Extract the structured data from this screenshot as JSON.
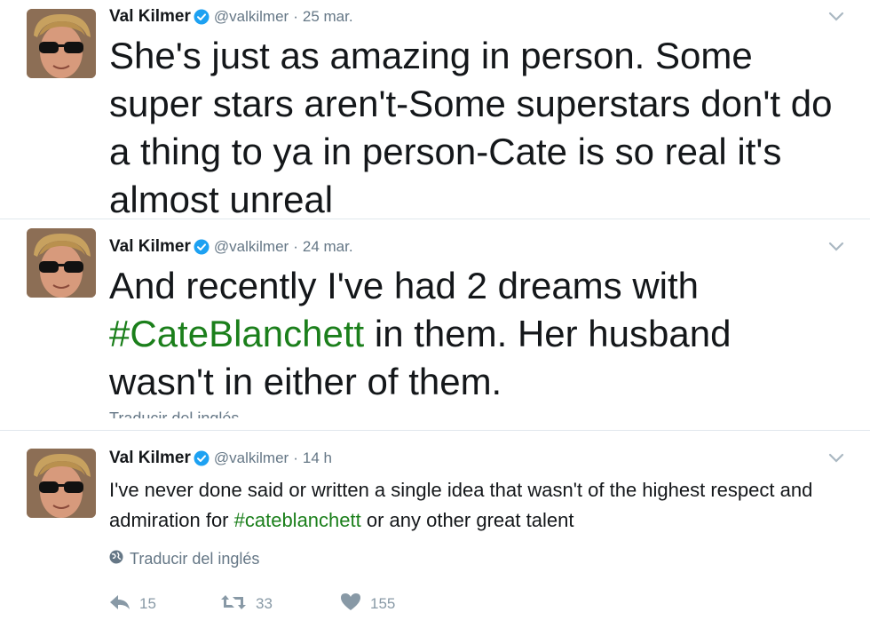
{
  "tweets": [
    {
      "author": "Val Kilmer",
      "handle": "@valkilmer",
      "separator": "·",
      "time": "25 mar.",
      "text_parts": [
        {
          "text": "She's just as amazing in person. Some super stars aren't-Some superstars don't do a thing to ya in person-Cate is so real it's almost unreal",
          "hashtag": false
        }
      ]
    },
    {
      "author": "Val Kilmer",
      "handle": "@valkilmer",
      "separator": "·",
      "time": "24 mar.",
      "text_parts": [
        {
          "text": "And recently I've had 2 dreams with ",
          "hashtag": false
        },
        {
          "text": "#CateBlanchett",
          "hashtag": true
        },
        {
          "text": " in them. Her husband wasn't in either of them.",
          "hashtag": false
        }
      ],
      "cut_text": "Traducir del inglés"
    },
    {
      "author": "Val Kilmer",
      "handle": "@valkilmer",
      "separator": "·",
      "time": "14 h",
      "text_parts": [
        {
          "text": "I've never done said or written a single idea that wasn't of the highest respect and admiration for ",
          "hashtag": false
        },
        {
          "text": "#cateblanchett",
          "hashtag": true
        },
        {
          "text": " or any other great talent",
          "hashtag": false
        }
      ],
      "translate_label": "Traducir del inglés",
      "actions": {
        "replies": "15",
        "retweets": "33",
        "likes": "155"
      }
    }
  ],
  "icons": {
    "verified": "verified-badge-icon",
    "chevron": "chevron-down-icon",
    "globe": "globe-icon",
    "reply": "reply-icon",
    "retweet": "retweet-icon",
    "like": "heart-icon"
  },
  "colors": {
    "hashtag": "#1b7f1b",
    "verified": "#1da1f2",
    "muted": "#657786",
    "action": "#8899a6"
  }
}
